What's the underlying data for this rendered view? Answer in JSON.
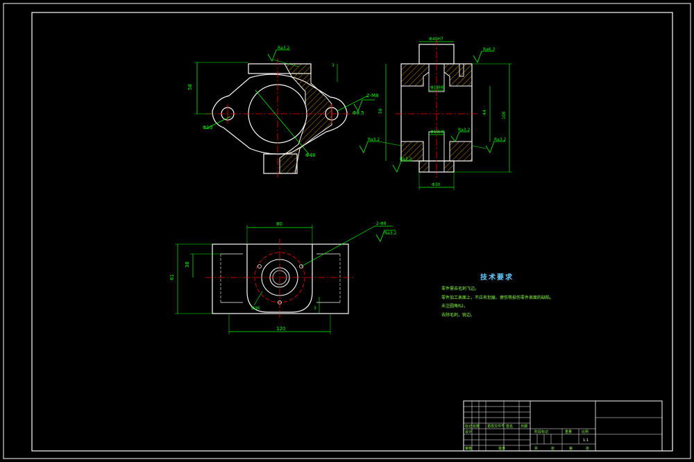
{
  "colors": {
    "background": "#000000",
    "outline": "#ffffff",
    "dimension": "#00ff00",
    "centerline": "#ff0000",
    "hatch": "#cc8800",
    "note_title": "#66ccff",
    "note_text": "#88ff44"
  },
  "tech_requirements": {
    "title": "技术要求",
    "lines": [
      "零件需去毛刺飞边。",
      "零件加工表面上，不应有划痕、擦伤等损伤零件表面的缺陷。",
      "未注圆角R2。",
      "去除毛刺，锐边。"
    ]
  },
  "dimensions": {
    "top_view_height": "58",
    "top_view_hole": "Φ10",
    "top_view_bore": "Φ48",
    "top_view_thread": "2-M8",
    "top_view_counterbore": "Φ8.5",
    "top_view_rough1": "Ra3.2",
    "top_view_rough2": "Ra3.2",
    "top_view_small": "3",
    "side_top": "Φ40H7",
    "side_mid": "Φ18H8",
    "side_low": "Φ18H8",
    "side_left_h": "58",
    "side_right_h1": "44",
    "side_right_h2": "106",
    "side_bottom_w": "Φ30",
    "side_rough_top": "Ra6.3",
    "side_rough_l": "Ra3.2",
    "side_rough_bl": "Ra3.2",
    "side_rough_r": "Ra3.2",
    "side_rough_mid": "Ra3.2",
    "front_top_w": "80",
    "front_holes": "2-Φ8",
    "front_rough": "Ra3.2",
    "front_left_h": "61",
    "front_left_h2": "38",
    "front_bottom_w": "120",
    "front_bore": "Φ36",
    "front_small": "3"
  },
  "title_block": {
    "left_labels": [
      "标记",
      "处数",
      "更改文件号",
      "签名",
      "日期",
      "设计",
      "审核",
      "批准"
    ],
    "middle_labels": [
      "阶段标记",
      "重量",
      "比例"
    ],
    "scale": "1:1",
    "bottom_labels": [
      "共",
      "张",
      "第",
      "张"
    ]
  }
}
